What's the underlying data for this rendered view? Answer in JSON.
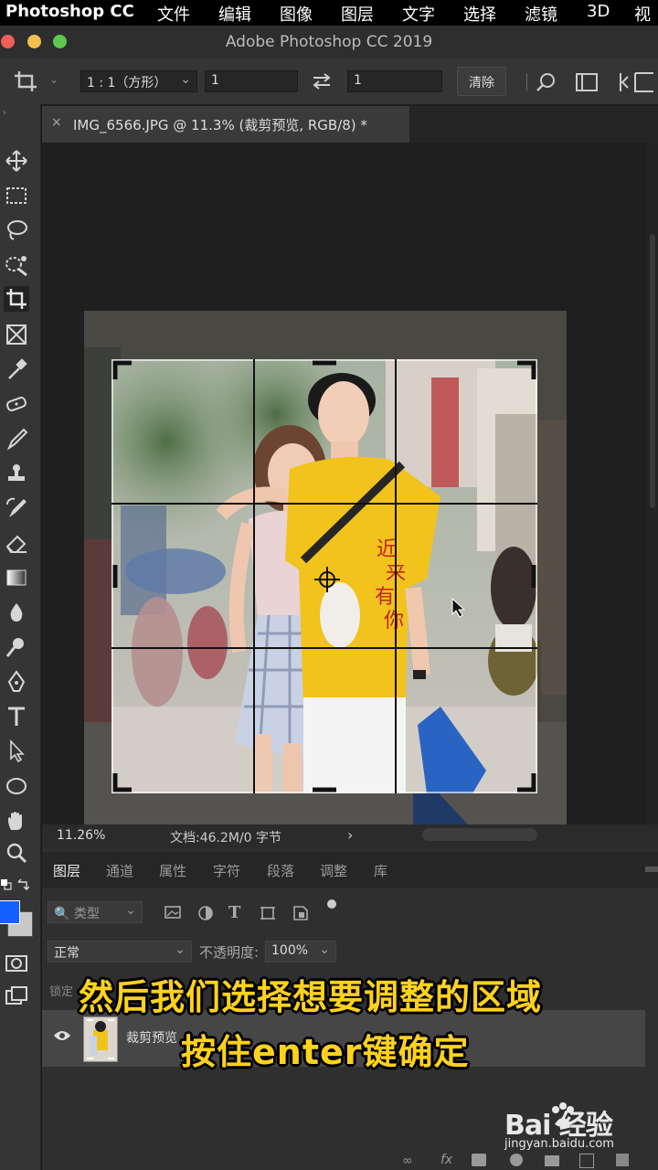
{
  "menubar": {
    "app": "Photoshop CC",
    "items": [
      "文件",
      "编辑",
      "图像",
      "图层",
      "文字",
      "选择",
      "滤镜",
      "3D",
      "视"
    ]
  },
  "window": {
    "title": "Adobe Photoshop CC 2019",
    "lights": {
      "close": "#ee5f58",
      "minimize": "#f4bd4f",
      "zoom": "#5dc74f"
    }
  },
  "options": {
    "ratio": "1 : 1（方形）",
    "width": "1",
    "height": "1",
    "clear": "清除",
    "swap_icon": "swap-arrows-icon"
  },
  "document": {
    "tab_label": "IMG_6566.JPG @ 11.3% (裁剪预览, RGB/8) *",
    "close": "×"
  },
  "status": {
    "zoom": "11.26%",
    "docinfo": "文档:46.2M/0 字节",
    "arrow": "›"
  },
  "panel": {
    "tabs": [
      "图层",
      "通道",
      "属性",
      "字符",
      "段落",
      "调整",
      "库"
    ],
    "filter_label": "类型",
    "blend_mode": "正常",
    "opacity_label": "不透明度:",
    "opacity_value": "100%",
    "lock_label": "锁定",
    "layer_name": "裁剪预览"
  },
  "captions": {
    "line1": "然后我们选择想要调整的区域",
    "line2": "按住enter键确定"
  },
  "photo": {
    "shirt_text": "近来有你"
  },
  "watermark": {
    "brand": "Bai 经验",
    "url": "jingyan.baidu.com"
  },
  "colors": {
    "foreground": "#1560ff",
    "background": "#c8c8c8",
    "caption": "#ffd21c"
  }
}
